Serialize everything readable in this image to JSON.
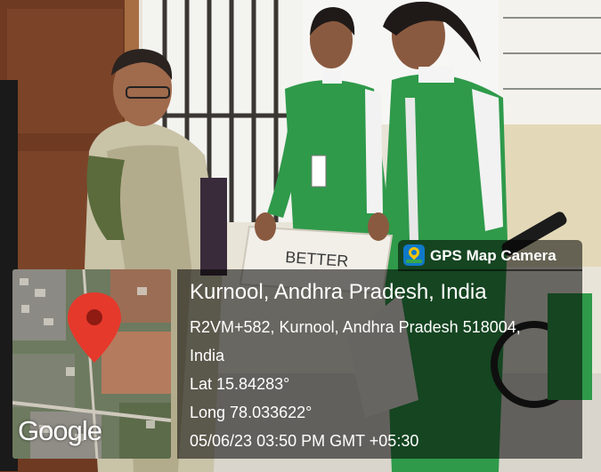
{
  "brand": {
    "name": "GPS Map Camera",
    "icon": "gps-map-camera-app-icon"
  },
  "map": {
    "provider": "Google",
    "marker_icon": "red-map-pin-icon"
  },
  "location": {
    "title": "Kurnool, Andhra Pradesh, India",
    "address_line1": "R2VM+582, Kurnool, Andhra Pradesh 518004,",
    "address_line2": "India",
    "latitude": "Lat 15.84283°",
    "longitude": "Long 78.033622°",
    "datetime": "05/06/23 03:50 PM GMT +05:30"
  },
  "scene": {
    "placard_text": "BETTER"
  },
  "colors": {
    "uniform_green": "#2f9a4a",
    "overlay_bg": "rgba(0,0,0,0.55)",
    "pin_red": "#e5392b"
  }
}
